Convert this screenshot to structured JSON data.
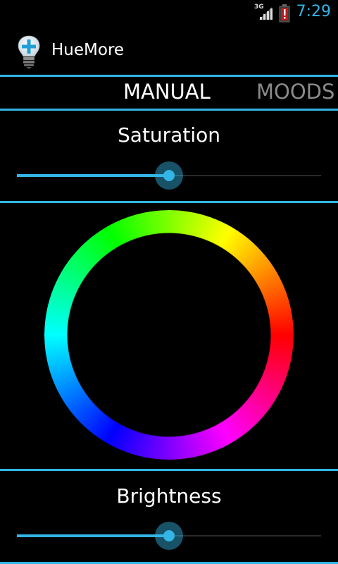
{
  "status_bar": {
    "network_type": "3G",
    "time": "7:29",
    "signal_icon": "signal-bars-icon",
    "battery_icon": "battery-alert-icon",
    "accent_color": "#33b5e5"
  },
  "action_bar": {
    "title": "HueMore",
    "icon": "lightbulb-plus-icon"
  },
  "tabs": [
    {
      "label": "MANUAL",
      "selected": true
    },
    {
      "label": "MOODS",
      "selected": false
    }
  ],
  "saturation": {
    "label": "Saturation",
    "value": 0.5
  },
  "color_wheel": {
    "hue_order_clockwise_from_right": [
      "red",
      "magenta",
      "blue",
      "cyan",
      "green",
      "yellow"
    ]
  },
  "brightness": {
    "label": "Brightness",
    "value": 0.5
  },
  "colors": {
    "accent": "#33b5e5",
    "background": "#000000",
    "inactive_tab": "#8a8a8a"
  }
}
